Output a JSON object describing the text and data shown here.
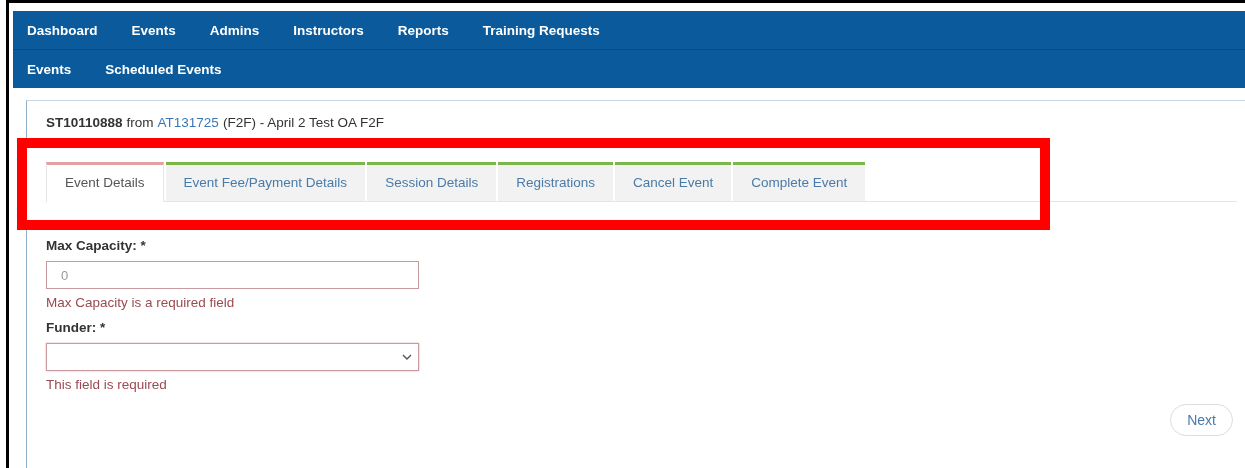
{
  "nav": {
    "main": [
      {
        "label": "Dashboard"
      },
      {
        "label": "Events"
      },
      {
        "label": "Admins"
      },
      {
        "label": "Instructors"
      },
      {
        "label": "Reports"
      },
      {
        "label": "Training Requests"
      }
    ],
    "sub": [
      {
        "label": "Events"
      },
      {
        "label": "Scheduled Events"
      }
    ]
  },
  "heading": {
    "id": "ST10110888",
    "from": "from",
    "link": "AT131725",
    "rest": "(F2F) - April 2 Test OA F2F"
  },
  "tabs": [
    {
      "label": "Event Details",
      "selected": true
    },
    {
      "label": "Event Fee/Payment Details",
      "selected": false
    },
    {
      "label": "Session Details",
      "selected": false
    },
    {
      "label": "Registrations",
      "selected": false
    },
    {
      "label": "Cancel Event",
      "selected": false
    },
    {
      "label": "Complete Event",
      "selected": false
    }
  ],
  "highlight": {
    "kind": "box"
  },
  "fields": [
    {
      "kind": "text",
      "label": "Max Capacity: *",
      "placeholder": "0",
      "error": "Max Capacity is a required field"
    },
    {
      "kind": "select",
      "label": "Funder: *",
      "error": "This field is required"
    }
  ],
  "buttons": [
    {
      "label": "Next"
    }
  ]
}
